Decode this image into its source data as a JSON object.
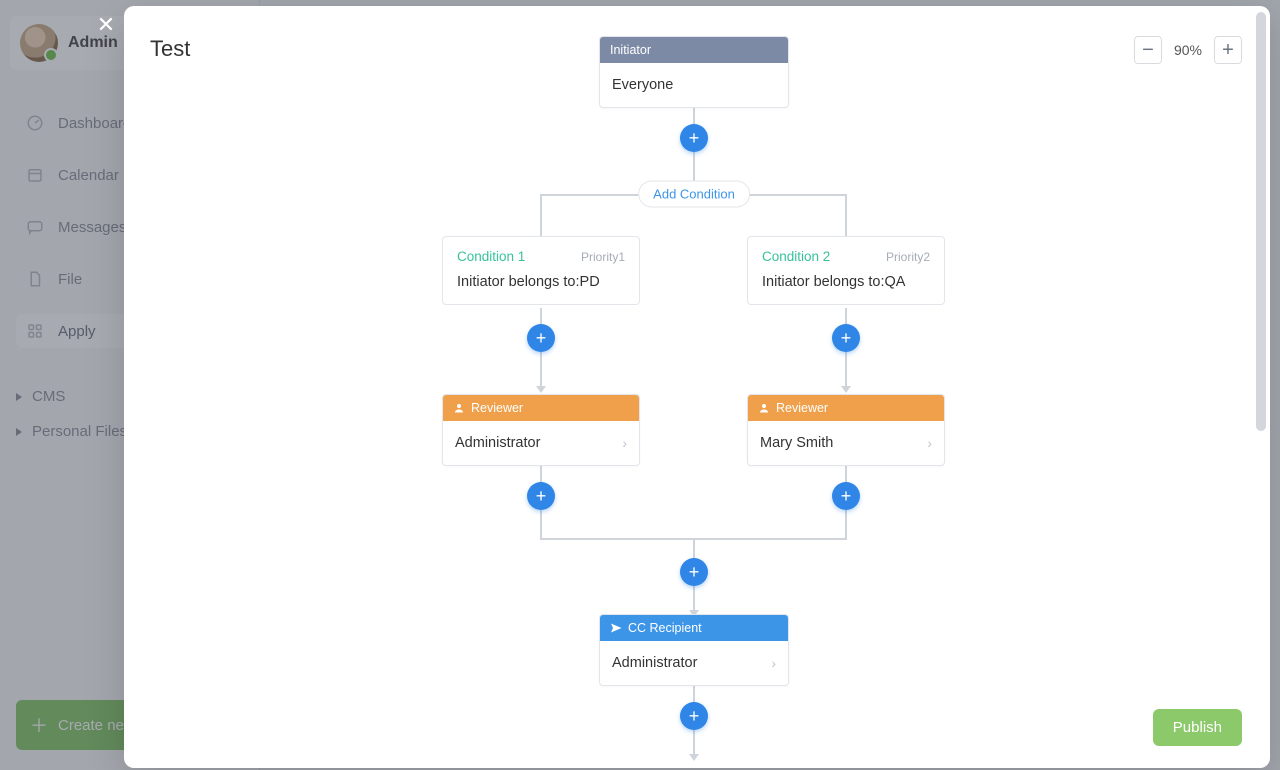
{
  "sidebar": {
    "profile_name": "Admin",
    "nav": {
      "dashboard": "Dashboard",
      "calendar": "Calendar",
      "messages": "Messages",
      "file": "File",
      "apply": "Apply"
    },
    "tree": {
      "cms": "CMS",
      "personal": "Personal Files"
    },
    "create_label": "Create new"
  },
  "panel": {
    "title": "Test",
    "zoom_level": "90%",
    "publish_label": "Publish"
  },
  "flow": {
    "initiator": {
      "header": "Initiator",
      "body": "Everyone"
    },
    "add_condition_label": "Add Condition",
    "branches": [
      {
        "condition": {
          "name": "Condition 1",
          "priority": "Priority1",
          "desc": "Initiator belongs to:PD"
        },
        "reviewer": {
          "header": "Reviewer",
          "name": "Administrator"
        }
      },
      {
        "condition": {
          "name": "Condition 2",
          "priority": "Priority2",
          "desc": "Initiator belongs to:QA"
        },
        "reviewer": {
          "header": "Reviewer",
          "name": "Mary Smith"
        }
      }
    ],
    "cc": {
      "header": "CC Recipient",
      "name": "Administrator"
    }
  }
}
